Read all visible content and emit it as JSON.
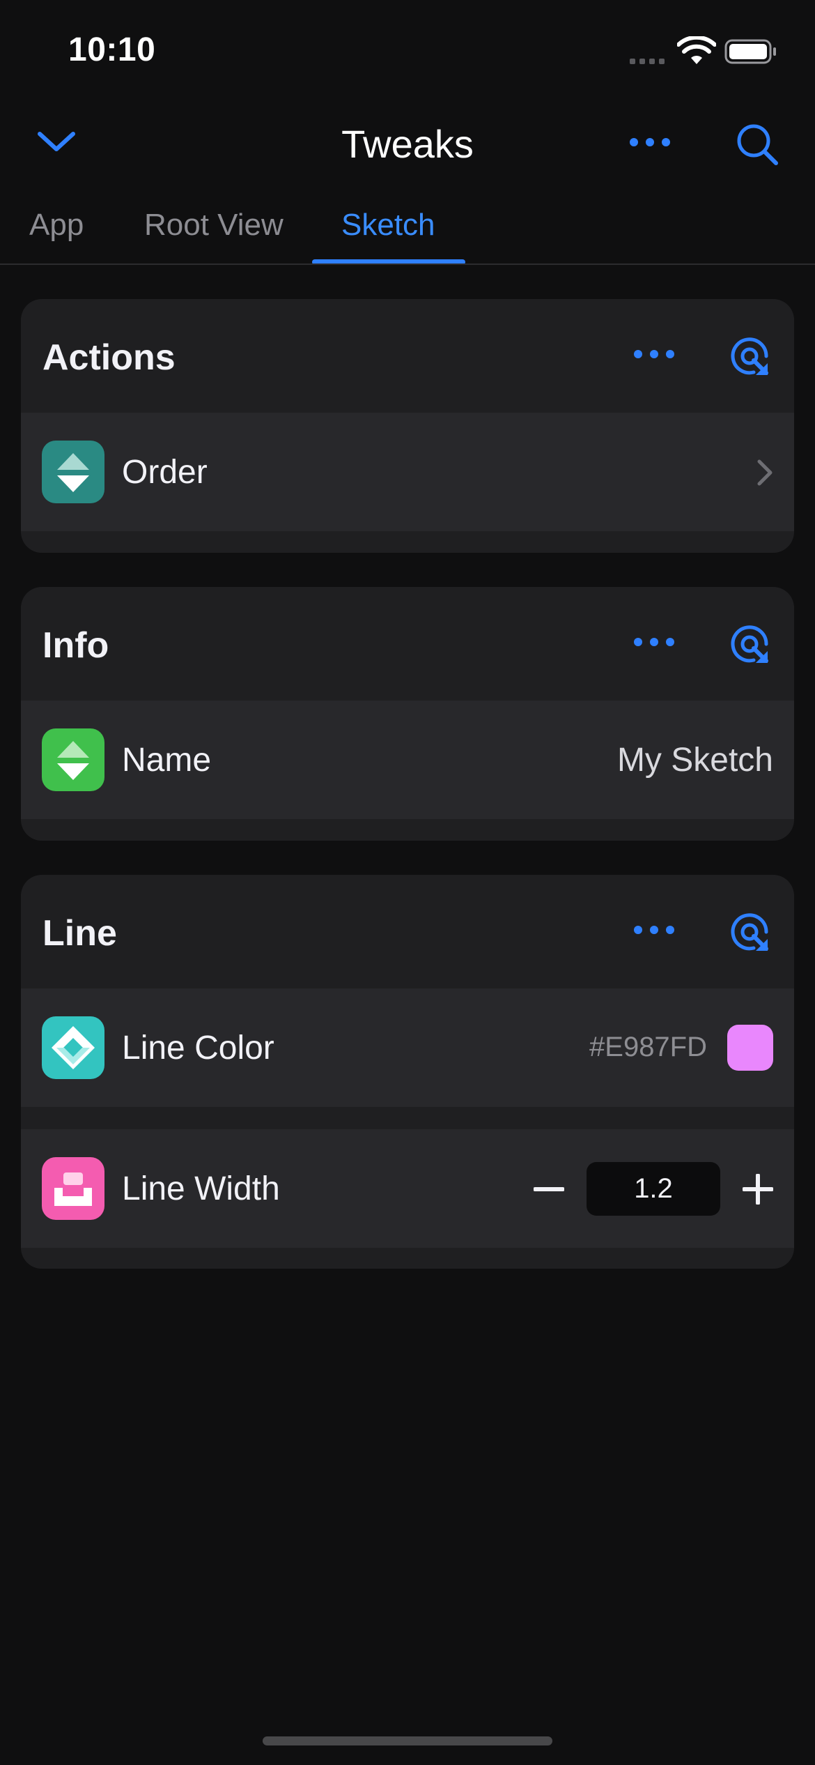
{
  "status_bar": {
    "time": "10:10"
  },
  "nav": {
    "title": "Tweaks"
  },
  "tabs": [
    {
      "label": "App",
      "active": false
    },
    {
      "label": "Root View",
      "active": false
    },
    {
      "label": "Sketch",
      "active": true
    }
  ],
  "sections": [
    {
      "title": "Actions",
      "rows": [
        {
          "label": "Order",
          "icon": "sort-arrows-icon",
          "icon_color": "#2a8a83",
          "accessory": "chevron-right-icon"
        }
      ]
    },
    {
      "title": "Info",
      "rows": [
        {
          "label": "Name",
          "icon": "sort-arrows-icon",
          "icon_color": "#40c04c",
          "value": "My Sketch"
        }
      ]
    },
    {
      "title": "Line",
      "rows": [
        {
          "label": "Line Color",
          "icon": "diamond-icon",
          "icon_color": "#33c4c0",
          "value": "#E987FD",
          "swatch_color": "#E987FD"
        },
        {
          "label": "Line Width",
          "icon": "tray-icon",
          "icon_color": "#f45cb0",
          "value": "1.2"
        }
      ]
    }
  ],
  "colors": {
    "accent": "#2f80ff",
    "background": "#0f0f10",
    "card": "#1f1f21",
    "row": "#28282b"
  }
}
